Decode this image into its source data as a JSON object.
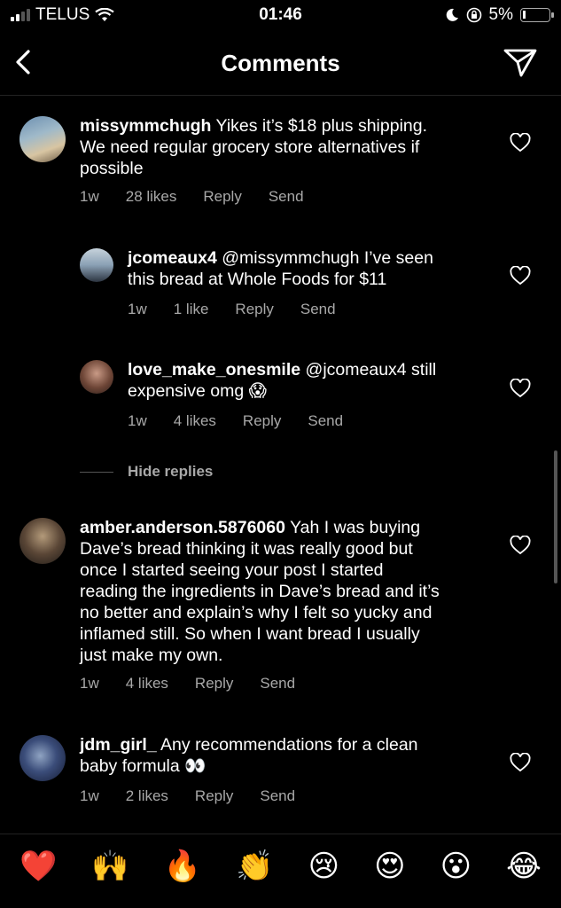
{
  "status": {
    "carrier": "TELUS",
    "time": "01:46",
    "battery": "5%"
  },
  "header": {
    "title": "Comments"
  },
  "comments": [
    {
      "username": "missymmchugh",
      "text": "Yikes it's $18 plus shipping. We need regular grocery store alternatives if possible",
      "lines": [
        "Yikes it’s $18 plus shipping.",
        "We need regular grocery store alternatives if",
        "possible"
      ],
      "time": "1w",
      "likes": "28 likes",
      "reply": "Reply",
      "send": "Send"
    },
    {
      "username": "jcomeaux4",
      "lines": [
        "@missymmchugh I’ve seen",
        "this bread at Whole Foods for $11"
      ],
      "time": "1w",
      "likes": "1 like",
      "reply": "Reply",
      "send": "Send"
    },
    {
      "username": "love_make_onesmile",
      "lines": [
        "@jcomeaux4 still",
        "expensive omg 😱"
      ],
      "time": "1w",
      "likes": "4 likes",
      "reply": "Reply",
      "send": "Send"
    },
    {
      "username": "amber.anderson.5876060",
      "lines": [
        "Yah I was buying",
        "Dave’s bread thinking it was really good but",
        "once I started seeing your post I started",
        "reading the ingredients in Dave’s bread and it’s",
        "no better and explain’s why I felt so yucky and",
        "inflamed still. So when I want bread I usually",
        "just make my own."
      ],
      "time": "1w",
      "likes": "4 likes",
      "reply": "Reply",
      "send": "Send"
    },
    {
      "username": "jdm_girl_",
      "lines": [
        "Any recommendations for a clean",
        "baby formula 👀"
      ],
      "time": "1w",
      "likes": "2 likes",
      "reply": "Reply",
      "send": "Send"
    }
  ],
  "hide_replies": "Hide replies",
  "emojis": [
    "❤️",
    "🙌",
    "🔥",
    "👏",
    "😢",
    "😍",
    "😮",
    "😂"
  ]
}
